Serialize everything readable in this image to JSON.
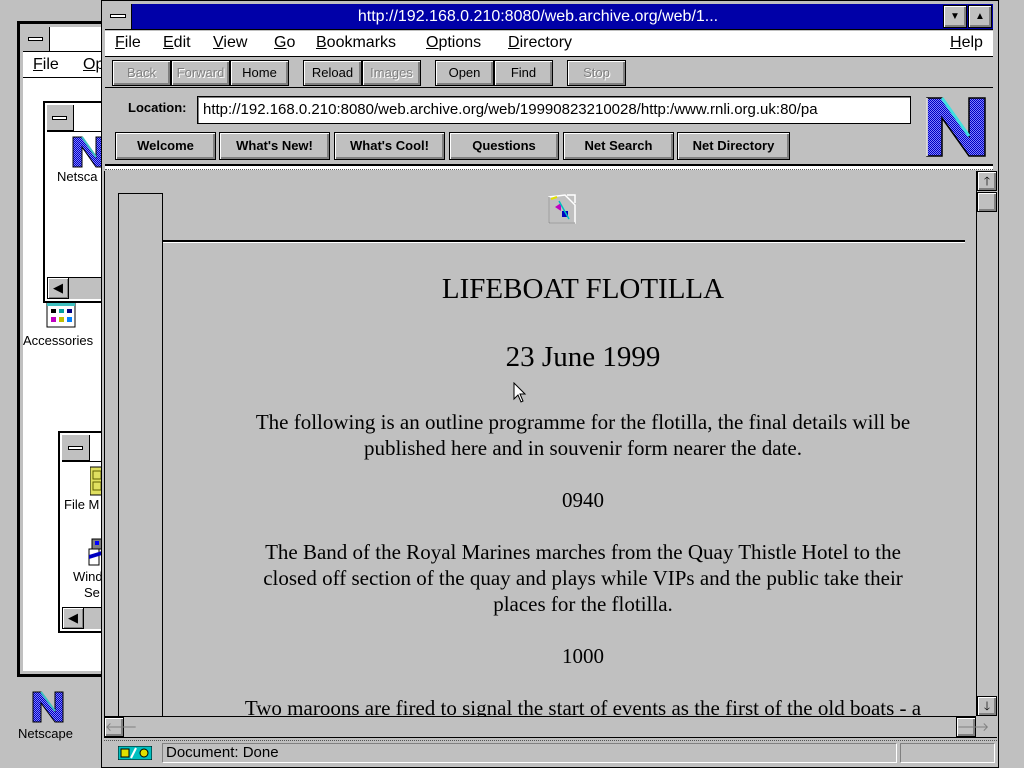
{
  "desktop": {
    "program_manager": {
      "menu": [
        {
          "label": "File",
          "ul": "F"
        },
        {
          "label": "Op",
          "ul": "O"
        }
      ]
    },
    "group_windows": [
      {
        "name": "netscape-group",
        "icons": [
          {
            "label": "Netsca",
            "icon": "netscape-icon"
          }
        ]
      },
      {
        "name": "main-group",
        "icons": [
          {
            "label": "File M",
            "icon": "file-manager-icon"
          },
          {
            "label": "Wind",
            "label2": "Se",
            "icon": "windows-setup-icon"
          }
        ]
      }
    ],
    "icons": [
      {
        "label": "Accessories",
        "icon": "accessories-icon"
      },
      {
        "label": "Netscape",
        "icon": "netscape-icon"
      }
    ]
  },
  "browser": {
    "title": "http://192.168.0.210:8080/web.archive.org/web/1...",
    "menu": [
      {
        "label": "File"
      },
      {
        "label": "Edit"
      },
      {
        "label": "View"
      },
      {
        "label": "Go"
      },
      {
        "label": "Bookmarks"
      },
      {
        "label": "Options"
      },
      {
        "label": "Directory"
      },
      {
        "label": "Help"
      }
    ],
    "toolbar": [
      {
        "label": "Back",
        "enabled": false
      },
      {
        "label": "Forward",
        "enabled": false
      },
      {
        "label": "Home",
        "enabled": true
      },
      {
        "label": "Reload",
        "enabled": true
      },
      {
        "label": "Images",
        "enabled": false
      },
      {
        "label": "Open",
        "enabled": true
      },
      {
        "label": "Find",
        "enabled": true
      },
      {
        "label": "Stop",
        "enabled": false
      }
    ],
    "location": {
      "label": "Location:",
      "value": "http://192.168.0.210:8080/web.archive.org/web/19990823210028/http:/www.rnli.org.uk:80/pa"
    },
    "directory_buttons": [
      {
        "label": "Welcome"
      },
      {
        "label": "What's New!"
      },
      {
        "label": "What's Cool!"
      },
      {
        "label": "Questions"
      },
      {
        "label": "Net Search"
      },
      {
        "label": "Net Directory"
      }
    ],
    "status": {
      "text": "Document: Done"
    }
  },
  "page": {
    "heading": "LIFEBOAT FLOTILLA",
    "date": "23 June 1999",
    "intro_line1": "The following is an outline programme for the flotilla, the final details will be",
    "intro_line2": "published here and in souvenir form nearer the date.",
    "time1": "0940",
    "para1_line1": "The Band of the Royal Marines marches from the Quay Thistle Hotel to the",
    "para1_line2": "closed off section of the quay and plays while VIPs and the public take their",
    "para1_line3": "places for the flotilla.",
    "time2": "1000",
    "para2_line1": "Two maroons are fired to signal the start of events as the first of the old boats - a"
  }
}
